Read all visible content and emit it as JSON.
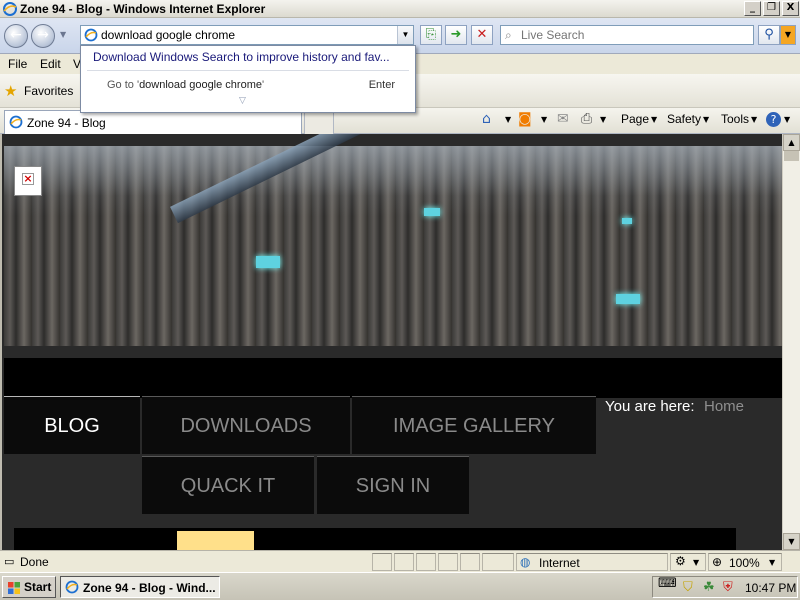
{
  "window": {
    "title": "Zone 94 - Blog - Windows Internet Explorer",
    "minimize_glyph": "_",
    "maximize_glyph": "❐",
    "close_glyph": "X"
  },
  "address": {
    "value": "download google chrome",
    "dropdown_glyph": "▼"
  },
  "search": {
    "placeholder": "Live Search"
  },
  "autocomplete": {
    "suggestion": "Download Windows Search to improve history and fav...",
    "goto_prefix": "Go to '",
    "goto_term": "download google chrome",
    "goto_suffix": "'",
    "enter_label": "Enter",
    "expand_glyph": "▽"
  },
  "menu": {
    "items": [
      "File",
      "Edit",
      "V"
    ]
  },
  "favorites": {
    "label": "Favorites"
  },
  "tab": {
    "label": "Zone 94 - Blog"
  },
  "commandbar": {
    "page": "Page",
    "safety": "Safety",
    "tools": "Tools"
  },
  "site": {
    "nav": [
      "BLOG",
      "DOWNLOADS",
      "IMAGE GALLERY",
      "QUACK IT",
      "SIGN IN"
    ],
    "breadcrumb_label": "You are here:",
    "breadcrumb_home": "Home"
  },
  "status": {
    "text": "Done",
    "zone": "Internet",
    "zoom": "100%"
  },
  "taskbar": {
    "start": "Start",
    "task": "Zone 94 - Blog - Wind...",
    "clock": "10:47 PM"
  },
  "colors": {
    "site_background": "#2a2a2a",
    "nav_active": "#ffffff",
    "nav_inactive": "#8a8a8a",
    "highlight_block": "#ffe08a"
  }
}
